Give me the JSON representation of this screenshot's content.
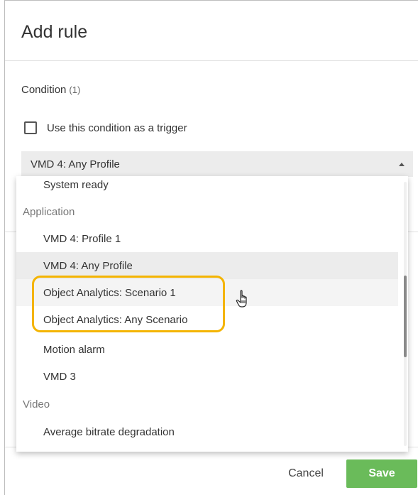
{
  "dialog": {
    "title": "Add rule"
  },
  "condition": {
    "label": "Condition",
    "count": "(1)",
    "trigger_checkbox_label": "Use this condition as a trigger",
    "trigger_checked": false,
    "selected_value": "VMD 4: Any Profile"
  },
  "dropdown": {
    "rows": [
      {
        "type": "item",
        "label": "System ready"
      },
      {
        "type": "group",
        "label": "Application"
      },
      {
        "type": "item",
        "label": "VMD 4: Profile 1"
      },
      {
        "type": "item",
        "label": "VMD 4: Any Profile",
        "state": "selected"
      },
      {
        "type": "item",
        "label": "Object Analytics: Scenario 1",
        "state": "hovered"
      },
      {
        "type": "item",
        "label": "Object Analytics: Any Scenario"
      },
      {
        "type": "item",
        "label": "Motion alarm"
      },
      {
        "type": "item",
        "label": "VMD 3"
      },
      {
        "type": "group",
        "label": "Video"
      },
      {
        "type": "item",
        "label": "Average bitrate degradation"
      }
    ]
  },
  "footer": {
    "cancel_label": "Cancel",
    "save_label": "Save"
  },
  "colors": {
    "save_button": "#6abb5a",
    "highlight_outline": "#f4b400",
    "selected_row": "#ececec"
  },
  "icons": {
    "select_arrow": "caret-up-icon",
    "cursor": "hand-pointer-icon",
    "checkbox": "checkbox-unchecked-icon"
  }
}
